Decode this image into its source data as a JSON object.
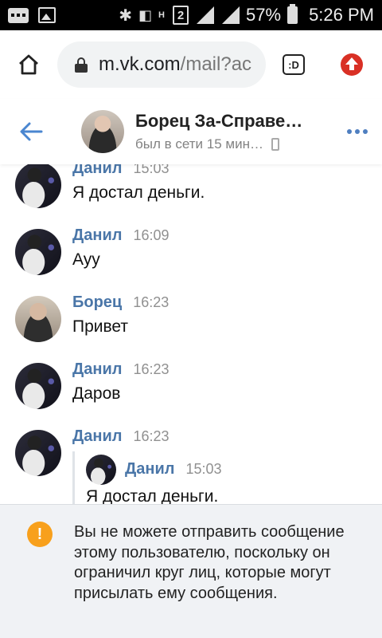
{
  "status_bar": {
    "nh_label": "H",
    "sim_label": "2",
    "battery": "57%",
    "time": "5:26 PM"
  },
  "browser": {
    "url_host": "m.vk.com",
    "url_path": "/mail?ac",
    "tabs_label": ":D"
  },
  "chat": {
    "name": "Борец За-Справе…",
    "status": "был в сети 15 мин…"
  },
  "messages": [
    {
      "author": "Данил",
      "time": "15:03",
      "text": "Я достал деньги."
    },
    {
      "author": "Данил",
      "time": "16:09",
      "text": "Ауу"
    },
    {
      "author": "Борец",
      "time": "16:23",
      "text": "Привет"
    },
    {
      "author": "Данил",
      "time": "16:23",
      "text": "Даров"
    },
    {
      "author": "Данил",
      "time": "16:23",
      "forwarded": {
        "author": "Данил",
        "time": "15:03",
        "text": "Я достал деньги."
      }
    }
  ],
  "notice": {
    "icon": "!",
    "text": "Вы не можете отправить сообщение этому пользователю, поскольку он ограничил круг лиц, которые могут присылать ему сообщения."
  },
  "colors": {
    "accent": "#4a76a8",
    "warning": "#f8a01c",
    "update": "#d93025"
  }
}
